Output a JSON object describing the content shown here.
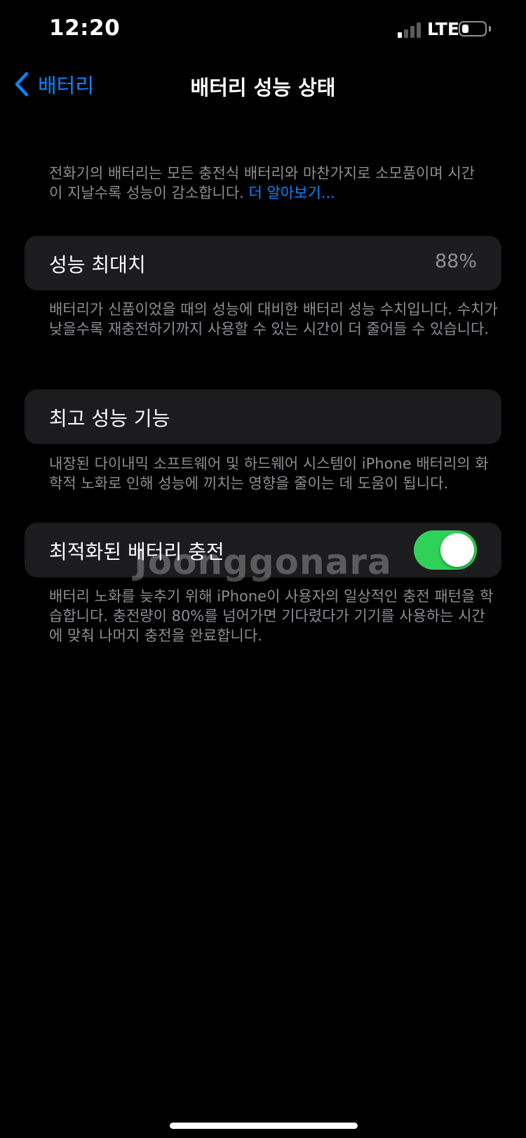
{
  "status_bar": {
    "time": "12:20",
    "network": "LTE",
    "signal_bars_active": 1,
    "battery_level_fraction": 0.3
  },
  "nav": {
    "back_label": "배터리",
    "title": "배터리 성능 상태",
    "back_icon": "chevron-left-icon"
  },
  "intro": {
    "text": "전화기의 배터리는 모든 충전식 배터리와 마찬가지로 소모품이며 시간이 지날수록 성능이 감소합니다. ",
    "link": "더 알아보기..."
  },
  "max_capacity": {
    "label": "성능 최대치",
    "value": "88%",
    "footer": "배터리가 신품이었을 때의 성능에 대비한 배터리 성능 수치입니다. 수치가 낮을수록 재충전하기까지 사용할 수 있는 시간이 더 줄어들 수 있습니다."
  },
  "peak_performance": {
    "label": "최고 성능 기능",
    "footer": "내장된 다이내믹 소프트웨어 및 하드웨어 시스템이 iPhone 배터리의 화학적 노화로 인해 성능에 끼치는 영향을 줄이는 데 도움이 됩니다."
  },
  "optimized_charging": {
    "label": "최적화된 배터리 충전",
    "toggle_on": true,
    "footer": "배터리 노화를 늦추기 위해 iPhone이 사용자의 일상적인 충전 패턴을 학습합니다. 충전량이 80%를 넘어가면 기다렸다가 기기를 사용하는 시간에 맞춰 나머지 충전을 완료합니다."
  },
  "watermark": "Joonggonara",
  "colors": {
    "accent_blue": "#0a84ff",
    "toggle_green": "#30d158",
    "cell_background": "#1c1c1e",
    "secondary_text": "#8e8e93"
  }
}
